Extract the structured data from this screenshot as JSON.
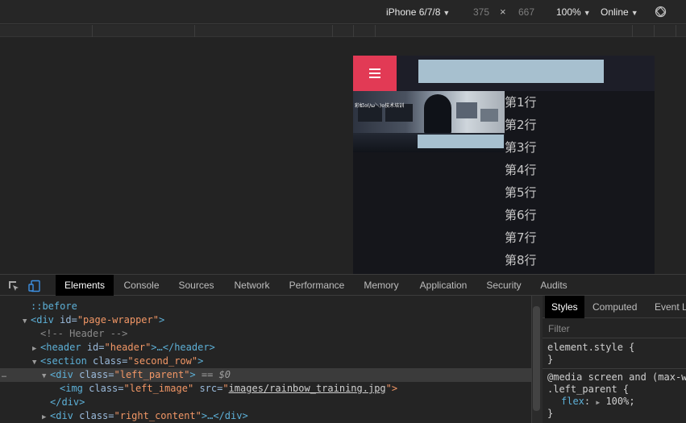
{
  "device_toolbar": {
    "device": "iPhone 6/7/8",
    "width": "375",
    "times": "×",
    "height": "667",
    "zoom": "100%",
    "throttle": "Online"
  },
  "mobile_page": {
    "rows": [
      "第1行",
      "第2行",
      "第3行",
      "第4行",
      "第5行",
      "第6行",
      "第7行",
      "第8行"
    ],
    "image_caption": "彩虹o(/ω＼)o技术培训",
    "accent_color": "#e23a55",
    "placeholder_color": "#a7c0cf"
  },
  "devtools": {
    "tabs": [
      "Elements",
      "Console",
      "Sources",
      "Network",
      "Performance",
      "Memory",
      "Application",
      "Security",
      "Audits"
    ],
    "active_tab": "Elements"
  },
  "elements": {
    "before": "::before",
    "div_open": "<div",
    "id_attr": "id=",
    "page_wrapper": "\"page-wrapper\"",
    "gt": ">",
    "comment": "<!-- Header -->",
    "header_open": "<header",
    "header_id": "\"header\"",
    "collapsed_header": ">…</header>",
    "section_open": "<section",
    "class_attr": "class=",
    "second_row": "\"second_row\"",
    "left_parent": "\"left_parent\"",
    "selected_marker": "== $0",
    "img_open": "<img",
    "left_image": "\"left_image\"",
    "src_attr": "src=",
    "quote_open": "\"",
    "src_value": "images/rainbow_training.jpg",
    "quote_close_gt": "\">",
    "div_close": "</div>",
    "right_content": "\"right_content\"",
    "collapsed_div": ">…</div>",
    "gutter_dots": "…"
  },
  "styles": {
    "tabs": [
      "Styles",
      "Computed",
      "Event L"
    ],
    "filter_placeholder": "Filter",
    "element_style": "element.style {",
    "close_brace": "}",
    "media": "@media screen and (max-w",
    "selector": ".left_parent {",
    "prop": "flex",
    "colon": ":",
    "value": "100%;"
  }
}
